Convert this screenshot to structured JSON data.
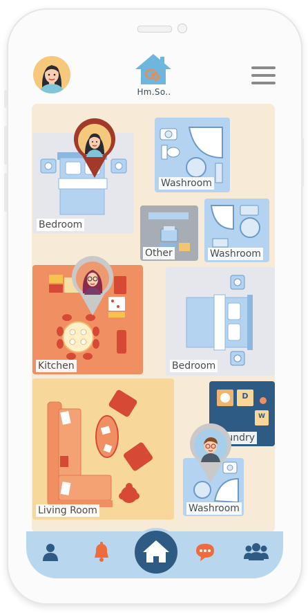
{
  "app": {
    "name": "Hm.So.."
  },
  "rooms": {
    "bedroom_top": "Bedroom",
    "washroom_top": "Washroom",
    "other": "Other",
    "washroom_mid": "Washroom",
    "kitchen": "Kitchen",
    "bedroom_mid": "Bedroom",
    "laundry": "Laundry",
    "living_room": "Living Room",
    "washroom_bottom": "Washroom"
  },
  "laundry_keys": [
    "D",
    "W"
  ],
  "nav": [
    "profile-icon",
    "bell-icon",
    "home-icon",
    "chat-icon",
    "group-icon"
  ],
  "colors": {
    "accent": "#2e5b83",
    "nav_bg": "#b9d6ef",
    "kitchen": "#ef8f62",
    "living": "#f8d79b",
    "pin_red": "#a23a2c",
    "pin_gray": "#c9c9c9"
  }
}
